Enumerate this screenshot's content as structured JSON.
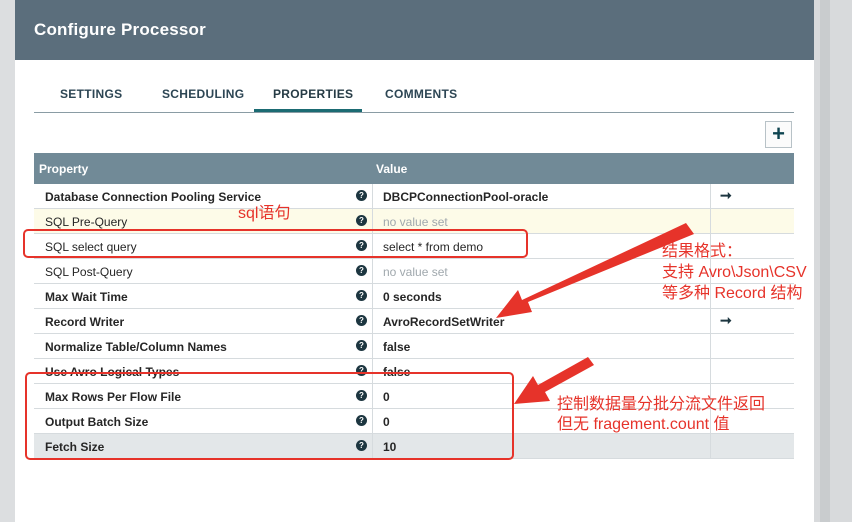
{
  "dialog": {
    "title": "Configure Processor"
  },
  "tabs": [
    {
      "label": "SETTINGS"
    },
    {
      "label": "SCHEDULING"
    },
    {
      "label": "PROPERTIES",
      "active": true
    },
    {
      "label": "COMMENTS"
    }
  ],
  "add_button": {
    "label": "+"
  },
  "table": {
    "headers": {
      "property": "Property",
      "value": "Value"
    },
    "rows": [
      {
        "name": "Database Connection Pooling Service",
        "value": "DBCPConnectionPool-oracle",
        "required": true,
        "has_goto": true
      },
      {
        "name": "SQL Pre-Query",
        "value": "no value set",
        "required": false,
        "value_set": false
      },
      {
        "name": "SQL select query",
        "value": "select * from demo",
        "required": false
      },
      {
        "name": "SQL Post-Query",
        "value": "no value set",
        "required": false,
        "value_set": false
      },
      {
        "name": "Max Wait Time",
        "value": "0 seconds",
        "required": true
      },
      {
        "name": "Record Writer",
        "value": "AvroRecordSetWriter",
        "required": true,
        "has_goto": true
      },
      {
        "name": "Normalize Table/Column Names",
        "value": "false",
        "required": true
      },
      {
        "name": "Use Avro Logical Types",
        "value": "false",
        "required": true
      },
      {
        "name": "Max Rows Per Flow File",
        "value": "0",
        "required": true
      },
      {
        "name": "Output Batch Size",
        "value": "0",
        "required": true
      },
      {
        "name": "Fetch Size",
        "value": "10",
        "required": true
      }
    ],
    "help_glyph": "?",
    "goto_glyph": "➞"
  },
  "annotations": {
    "sql_label": "sql语句",
    "format_line1": "结果格式：",
    "format_line2": "支持 Avro\\Json\\CSV",
    "format_line3": "等多种 Record 结构",
    "control_line1": "控制数据量分批分流文件返回",
    "control_line2": "但无 fragement.count 值",
    "color": "#e6332a"
  },
  "colors": {
    "header_bg": "#5b6e7c",
    "table_header_bg": "#718a97",
    "tab_accent": "#1b6b73",
    "annotation_red": "#e6332a"
  }
}
